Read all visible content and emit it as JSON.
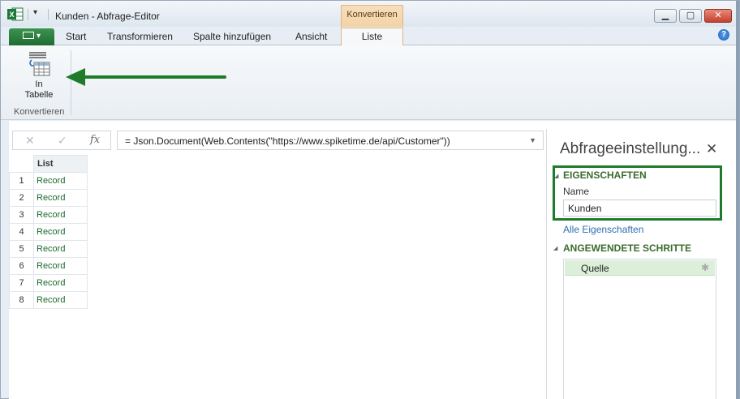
{
  "window": {
    "title": "Kunden - Abfrage-Editor",
    "context_group": "Konvertieren"
  },
  "ribbon": {
    "tabs": [
      "Start",
      "Transformieren",
      "Spalte hinzufügen",
      "Ansicht",
      "Liste"
    ],
    "active_tab": "Liste",
    "button_in_tabelle": {
      "line1": "In",
      "line2": "Tabelle"
    },
    "group_label": "Konvertieren"
  },
  "formula_bar": {
    "cancel_glyph": "✕",
    "confirm_glyph": "✓",
    "fx_glyph": "fx",
    "formula": "= Json.Document(Web.Contents(\"https://www.spiketime.de/api/Customer\"))"
  },
  "grid": {
    "column_header": "List",
    "rows": [
      {
        "n": "1",
        "value": "Record"
      },
      {
        "n": "2",
        "value": "Record"
      },
      {
        "n": "3",
        "value": "Record"
      },
      {
        "n": "4",
        "value": "Record"
      },
      {
        "n": "5",
        "value": "Record"
      },
      {
        "n": "6",
        "value": "Record"
      },
      {
        "n": "7",
        "value": "Record"
      },
      {
        "n": "8",
        "value": "Record"
      }
    ]
  },
  "settings_pane": {
    "title": "Abfrageeinstellung...",
    "properties_heading": "EIGENSCHAFTEN",
    "name_label": "Name",
    "name_value": "Kunden",
    "all_properties_link": "Alle Eigenschaften",
    "applied_steps_heading": "ANGEWENDETE SCHRITTE",
    "steps": [
      "Quelle"
    ]
  },
  "colors": {
    "accent_green": "#1e7b2a",
    "context_orange": "#f3d3a4",
    "record_text": "#1d6b2e"
  },
  "icons": [
    "excel-icon",
    "table-convert-icon",
    "help-icon",
    "gear-icon",
    "close-icon",
    "dropdown-icon"
  ]
}
